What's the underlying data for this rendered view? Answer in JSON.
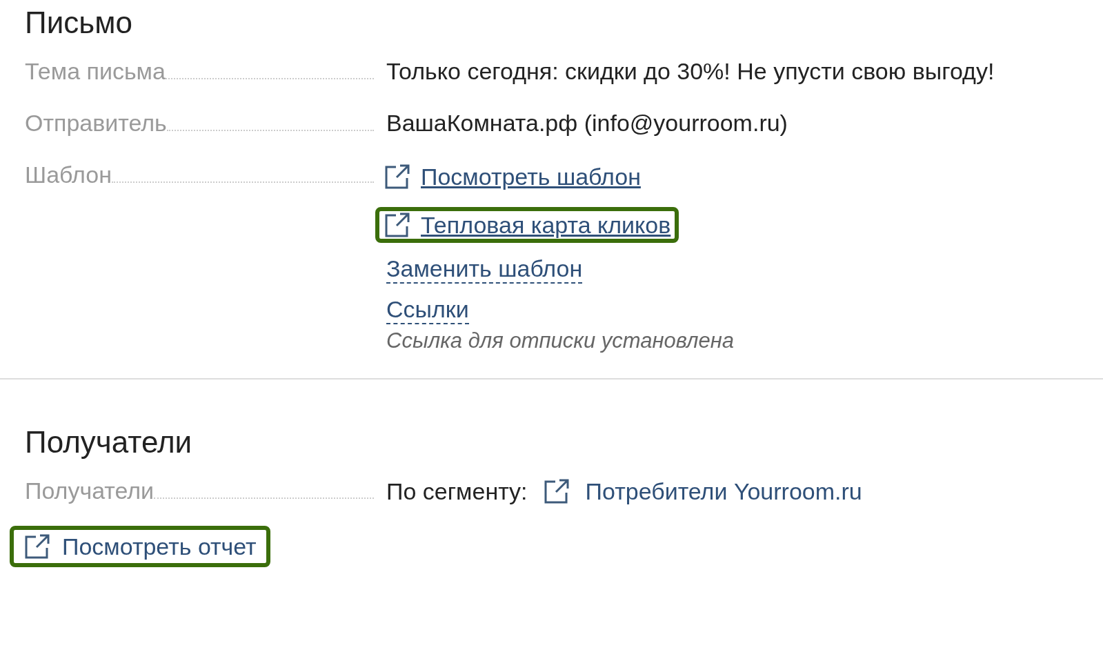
{
  "letter": {
    "title": "Письмо",
    "fields": [
      {
        "label": "Тема письма",
        "value": "Только сегодня: скидки до 30%! Не упусти свою выгоду!"
      },
      {
        "label": "Отправитель",
        "value": "ВашаКомната.рф (info@yourroom.ru)"
      }
    ],
    "template": {
      "label": "Шаблон",
      "items": [
        {
          "kind": "external",
          "text": "Посмотреть шаблон",
          "highlighted": false
        },
        {
          "kind": "external",
          "text": "Тепловая карта кликов",
          "highlighted": true
        },
        {
          "kind": "dashed",
          "text": "Заменить шаблон",
          "highlighted": false
        },
        {
          "kind": "dashed",
          "text": "Ссылки",
          "highlighted": false
        },
        {
          "kind": "note",
          "text": "Ссылка для отписки установлена",
          "highlighted": false
        }
      ]
    }
  },
  "recipients": {
    "title": "Получатели",
    "label": "Получатели",
    "prefix": "По сегменту:",
    "segment": "Потребители Yourroom.ru",
    "report": {
      "text": "Посмотреть отчет",
      "highlighted": true
    }
  }
}
